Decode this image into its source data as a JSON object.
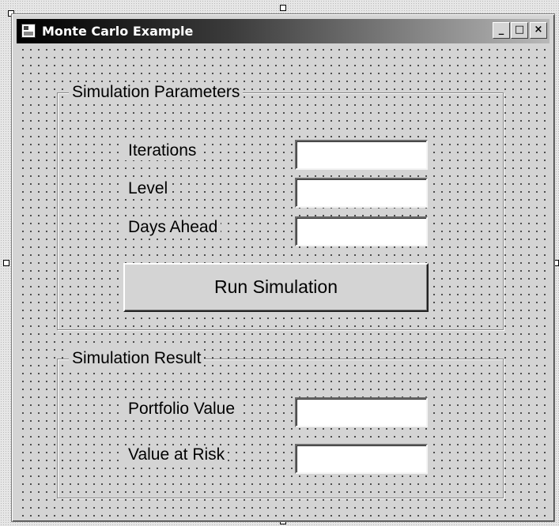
{
  "window": {
    "title": "Monte Carlo Example",
    "minimize_glyph": "_",
    "maximize_glyph": "□",
    "close_glyph": "×"
  },
  "parameters": {
    "group_title": "Simulation Parameters",
    "iterations_label": "Iterations",
    "iterations_value": "",
    "level_label": "Level",
    "level_value": "",
    "days_ahead_label": "Days Ahead",
    "days_ahead_value": "",
    "run_button_label": "Run Simulation"
  },
  "result": {
    "group_title": "Simulation Result",
    "portfolio_value_label": "Portfolio Value",
    "portfolio_value": "",
    "value_at_risk_label": "Value at Risk",
    "value_at_risk": ""
  }
}
